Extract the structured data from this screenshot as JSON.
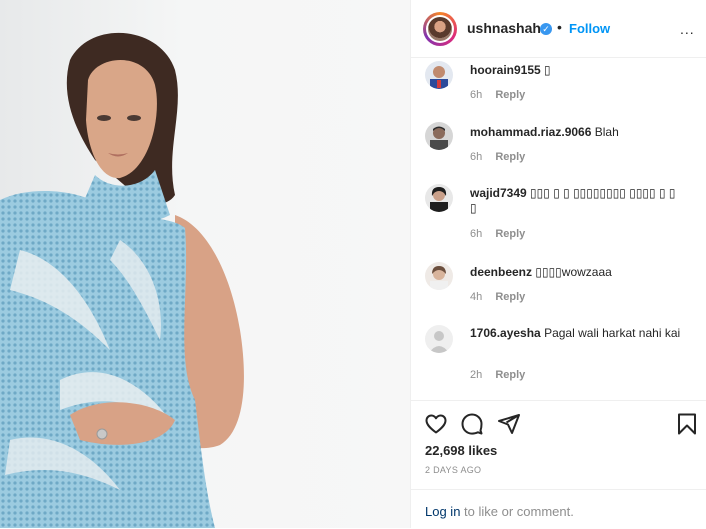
{
  "post": {
    "author": {
      "username": "ushnashah",
      "verified_icon": "verified-badge-icon",
      "separator": "•",
      "follow_label": "Follow",
      "more_label": "..."
    },
    "comments": [
      {
        "username": "hoorain9155",
        "text": "▯",
        "time": "6h",
        "reply_label": "Reply"
      },
      {
        "username": "mohammad.riaz.9066",
        "text": "Blah",
        "time": "6h",
        "reply_label": "Reply"
      },
      {
        "username": "wajid7349",
        "text": "▯▯▯ ▯ ▯ ▯▯▯▯▯▯▯▯ ▯▯▯▯ ▯ ▯ ▯",
        "time": "6h",
        "reply_label": "Reply"
      },
      {
        "username": "deenbeenz",
        "text": "▯▯▯▯wowzaaa",
        "time": "4h",
        "reply_label": "Reply"
      },
      {
        "username": "1706.ayesha",
        "text": "Pagal wali harkat nahi kai",
        "time": "2h",
        "reply_label": "Reply"
      }
    ],
    "actions": {
      "like_icon": "heart-icon",
      "comment_icon": "comment-icon",
      "share_icon": "share-icon",
      "save_icon": "bookmark-icon"
    },
    "likes": "22,698 likes",
    "date": "2 DAYS AGO",
    "login": {
      "link_label": "Log in",
      "rest_text": " to like or comment."
    }
  },
  "colors": {
    "link_blue": "#0095f6",
    "verified_blue": "#3897f0",
    "text_primary": "#262626",
    "text_secondary": "#8e8e8e",
    "dress_blue": "#8fc3db"
  }
}
